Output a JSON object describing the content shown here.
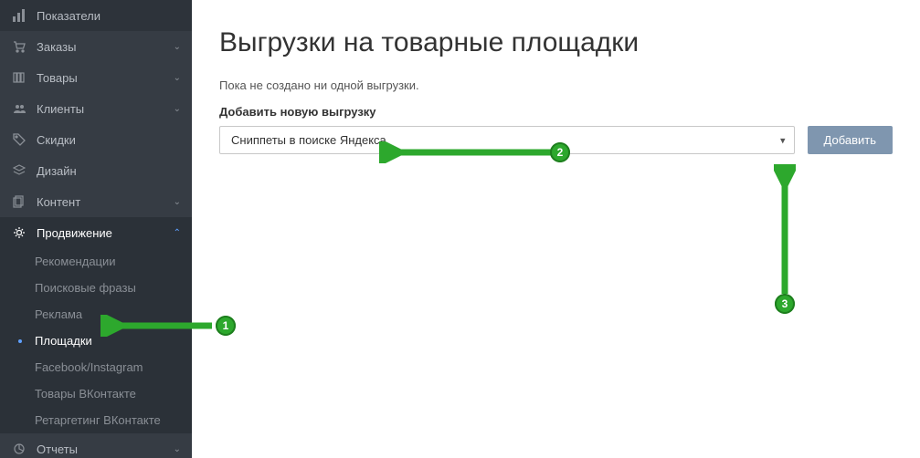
{
  "sidebar": {
    "items": [
      {
        "label": "Показатели",
        "icon": "bars-icon",
        "chevron": false
      },
      {
        "label": "Заказы",
        "icon": "cart-icon",
        "chevron": true
      },
      {
        "label": "Товары",
        "icon": "books-icon",
        "chevron": true
      },
      {
        "label": "Клиенты",
        "icon": "users-icon",
        "chevron": true
      },
      {
        "label": "Скидки",
        "icon": "tag-icon",
        "chevron": false
      },
      {
        "label": "Дизайн",
        "icon": "layers-icon",
        "chevron": false
      },
      {
        "label": "Контент",
        "icon": "copy-icon",
        "chevron": true
      },
      {
        "label": "Продвижение",
        "icon": "gear-icon",
        "chevron": true,
        "active": true
      },
      {
        "label": "Отчеты",
        "icon": "piechart-icon",
        "chevron": true
      }
    ],
    "sub": [
      {
        "label": "Рекомендации"
      },
      {
        "label": "Поисковые фразы"
      },
      {
        "label": "Реклама"
      },
      {
        "label": "Площадки",
        "selected": true
      },
      {
        "label": "Facebook/Instagram"
      },
      {
        "label": "Товары ВКонтакте"
      },
      {
        "label": "Ретаргетинг ВКонтакте"
      }
    ]
  },
  "main": {
    "title": "Выгрузки на товарные площадки",
    "empty_msg": "Пока не создано ни одной выгрузки.",
    "form_label": "Добавить новую выгрузку",
    "select_value": "Сниппеты в поиске Яндекса",
    "add_button": "Добавить"
  },
  "callouts": {
    "c1": "1",
    "c2": "2",
    "c3": "3"
  }
}
